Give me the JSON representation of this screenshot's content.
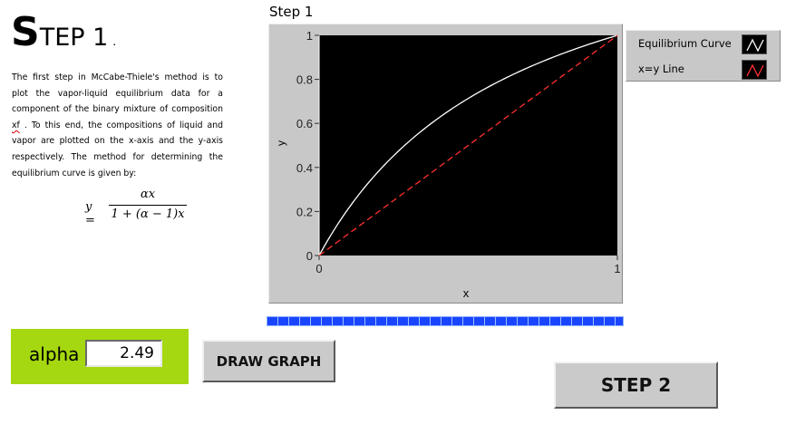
{
  "header": {
    "title_first_letter": "S",
    "title_rest": "TEP 1",
    "title_suffix": "."
  },
  "description": {
    "before_xf": "The first step in McCabe-Thiele's method is to plot the vapor-liquid equilibrium data for a component of the binary mixture of composition ",
    "xf": "xf",
    "after_xf": " . To this end, the compositions of liquid and vapor are plotted on the x-axis and the y-axis respectively. The method for determining the equilibrium curve is given by:"
  },
  "formula": {
    "lhs": "y =",
    "numerator": "αx",
    "denominator": "1 + (α − 1)x"
  },
  "graph": {
    "title": "Step 1",
    "xlabel": "x",
    "ylabel": "y",
    "x_ticks": [
      "0",
      "1"
    ],
    "y_ticks": [
      "0",
      "0.2",
      "0.4",
      "0.6",
      "0.8",
      "1"
    ]
  },
  "legend": {
    "items": [
      {
        "label": "Equilibrium Curve",
        "color": "#ffffff",
        "icon": "line-sample-icon"
      },
      {
        "label": "x=y Line",
        "color": "#ff3030",
        "icon": "line-sample-icon"
      }
    ]
  },
  "controls": {
    "alpha_label": "alpha",
    "alpha_value": "2.49",
    "draw_button": "DRAW GRAPH",
    "next_button": "STEP 2"
  },
  "progress": {
    "fraction": 1.0
  },
  "chart_data": {
    "type": "line",
    "title": "Step 1",
    "xlabel": "x",
    "ylabel": "y",
    "xlim": [
      0,
      1
    ],
    "ylim": [
      0,
      1
    ],
    "alpha": 2.49,
    "background": "#000000",
    "grid": false,
    "legend_position": "right",
    "series": [
      {
        "name": "Equilibrium Curve",
        "color": "#ffffff",
        "style": "solid",
        "x": [
          0,
          0.1,
          0.2,
          0.3,
          0.4,
          0.5,
          0.6,
          0.7,
          0.8,
          0.9,
          1.0
        ],
        "y": [
          0,
          0.217,
          0.384,
          0.516,
          0.624,
          0.713,
          0.789,
          0.853,
          0.909,
          0.957,
          1.0
        ]
      },
      {
        "name": "x=y Line",
        "color": "#ff3030",
        "style": "dashed",
        "x": [
          0,
          1
        ],
        "y": [
          0,
          1
        ]
      }
    ]
  }
}
